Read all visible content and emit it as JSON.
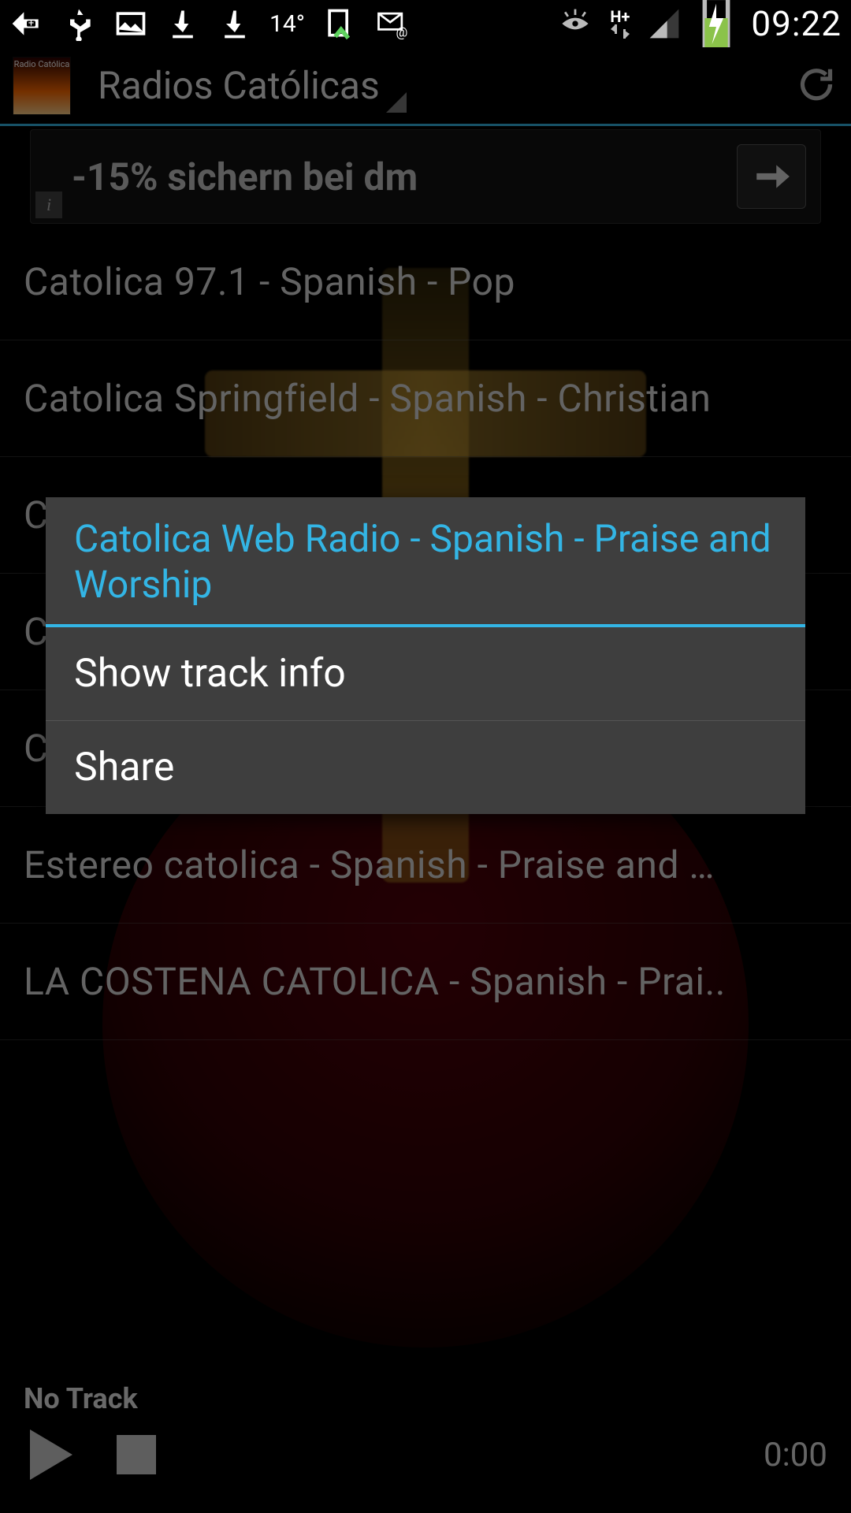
{
  "status_bar": {
    "clock": "09:22",
    "temperature": "14°",
    "network_text": "H+"
  },
  "action_bar": {
    "app_icon_caption": "Radio Católica",
    "title": "Radios Católicas"
  },
  "ad": {
    "text": "-15% sichern bei dm",
    "info_glyph": "i"
  },
  "stations": [
    {
      "label": "Catolica 97.1 - Spanish - Pop"
    },
    {
      "label": "Catolica Springfield - Spanish - Christian"
    },
    {
      "label": "C"
    },
    {
      "label": "C"
    },
    {
      "label": "C"
    },
    {
      "label": "Estereo catolica  - Spanish - Praise and …"
    },
    {
      "label": "LA COSTENA CATOLICA - Spanish - Prai.."
    }
  ],
  "player": {
    "track_title": "No Track",
    "time": "0:00"
  },
  "dialog": {
    "title": "Catolica Web Radio - Spanish - Praise and Worship",
    "option_track_info": "Show track info",
    "option_share": "Share"
  },
  "colors": {
    "accent": "#33b5e5"
  }
}
